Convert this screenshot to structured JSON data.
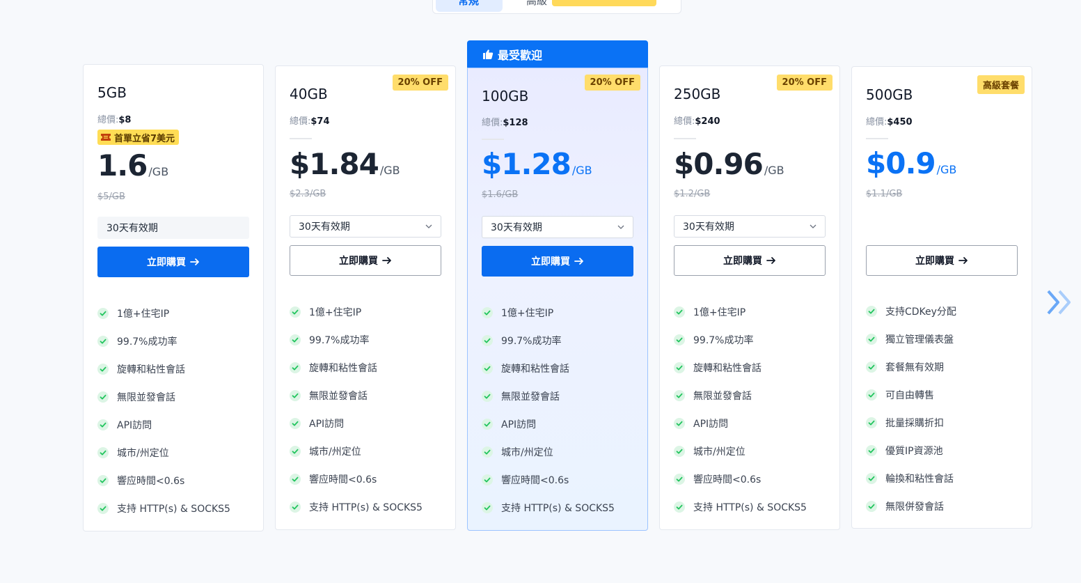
{
  "tabs": [
    {
      "label": "常規"
    },
    {
      "label": "高級"
    }
  ],
  "popular_label": "最受歡迎",
  "total_label": "總價:",
  "colors": {
    "accent": "#0a6cf0",
    "badge": "#ffdd6b",
    "check": "#22c55e"
  },
  "plans": [
    {
      "name": "5GB",
      "total": "$8",
      "coupon": "首單立省7美元",
      "price": "1.6",
      "unit": "/GB",
      "old_price": "$5/GB",
      "validity": "30天有效期",
      "cta": "立即購買",
      "features": [
        "1億+住宅IP",
        "99.7%成功率",
        "旋轉和粘性會話",
        "無限並發會話",
        "API訪問",
        "城市/州定位",
        "響应時間<0.6s",
        "支持 HTTP(s) & SOCKS5"
      ]
    },
    {
      "name": "40GB",
      "total": "$74",
      "badge": "20% OFF",
      "price": "$1.84",
      "unit": "/GB",
      "old_price": "$2.3/GB",
      "validity": "30天有效期",
      "cta": "立即購買",
      "features": [
        "1億+住宅IP",
        "99.7%成功率",
        "旋轉和粘性會話",
        "無限並發會話",
        "API訪問",
        "城市/州定位",
        "響应時間<0.6s",
        "支持 HTTP(s) & SOCKS5"
      ]
    },
    {
      "name": "100GB",
      "total": "$128",
      "badge": "20% OFF",
      "price": "$1.28",
      "unit": "/GB",
      "old_price": "$1.6/GB",
      "validity": "30天有效期",
      "cta": "立即購買",
      "features": [
        "1億+住宅IP",
        "99.7%成功率",
        "旋轉和粘性會話",
        "無限並發會話",
        "API訪問",
        "城市/州定位",
        "響应時間<0.6s",
        "支持 HTTP(s) & SOCKS5"
      ]
    },
    {
      "name": "250GB",
      "total": "$240",
      "badge": "20% OFF",
      "price": "$0.96",
      "unit": "/GB",
      "old_price": "$1.2/GB",
      "validity": "30天有效期",
      "cta": "立即購買",
      "features": [
        "1億+住宅IP",
        "99.7%成功率",
        "旋轉和粘性會話",
        "無限並發會話",
        "API訪問",
        "城市/州定位",
        "響应時間<0.6s",
        "支持 HTTP(s) & SOCKS5"
      ]
    },
    {
      "name": "500GB",
      "total": "$450",
      "badge": "高級套餐",
      "price": "$0.9",
      "unit": "/GB",
      "old_price": "$1.1/GB",
      "cta": "立即購買",
      "features": [
        "支持CDKey分配",
        "獨立管理儀表盤",
        "套餐無有效期",
        "可自由轉售",
        "批量採購折扣",
        "優質IP資源池",
        "輪換和粘性會話",
        "無限併發會話"
      ]
    }
  ]
}
